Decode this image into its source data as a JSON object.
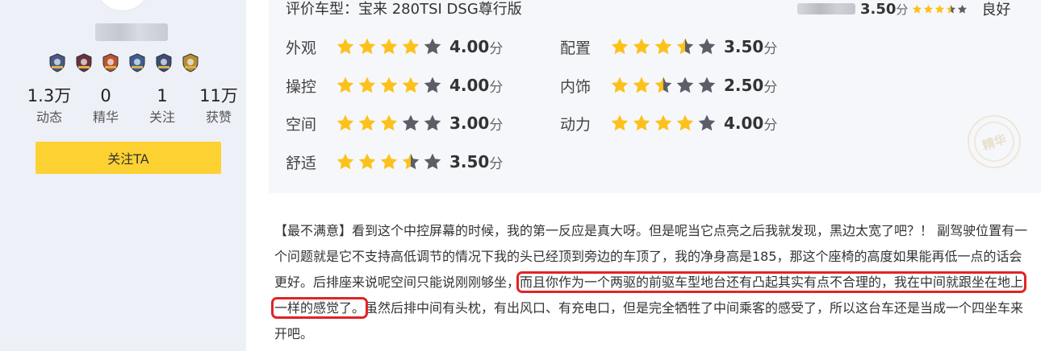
{
  "profile": {
    "avatar_icon": "avatar-circle-icon",
    "username_state": "blurred",
    "badges": [
      {
        "icon": "shield-badge-icon",
        "color": "#4a5a84"
      },
      {
        "icon": "helmet-badge-icon",
        "color": "#6c3138"
      },
      {
        "icon": "crest-badge-icon",
        "color": "#c0532b"
      },
      {
        "icon": "wing-badge-icon",
        "color": "#3f5f8f"
      },
      {
        "icon": "rank-badge-icon",
        "color": "#3e4d75"
      },
      {
        "icon": "medal-badge-icon",
        "color": "#b98e2c"
      }
    ],
    "stats": [
      {
        "value": "1.3万",
        "label": "动态"
      },
      {
        "value": "0",
        "label": "精华"
      },
      {
        "value": "1",
        "label": "关注"
      },
      {
        "value": "11万",
        "label": "获赞"
      }
    ],
    "follow_label": "关注TA"
  },
  "review_card": {
    "car_model": "评价车型：宝来 280TSI DSG尊行版",
    "overall": {
      "score": "3.50",
      "unit": "分",
      "stars": 3.5,
      "text": "良好"
    },
    "ratings": [
      {
        "label": "外观",
        "score": "4.00",
        "value": 4.0,
        "unit": "分"
      },
      {
        "label": "配置",
        "score": "3.50",
        "value": 3.5,
        "unit": "分"
      },
      {
        "label": "操控",
        "score": "4.00",
        "value": 4.0,
        "unit": "分"
      },
      {
        "label": "内饰",
        "score": "2.50",
        "value": 2.5,
        "unit": "分"
      },
      {
        "label": "空间",
        "score": "3.00",
        "value": 3.0,
        "unit": "分"
      },
      {
        "label": "动力",
        "score": "4.00",
        "value": 4.0,
        "unit": "分"
      },
      {
        "label": "舒适",
        "score": "3.50",
        "value": 3.5,
        "unit": "分"
      }
    ],
    "essence_seal": "精华"
  },
  "review": {
    "part1": "【最不满意】看到这个中控屏幕的时候，我的第一反应是真大呀。但是呢当它点亮之后我就发现，黑边太宽了吧？！ 副驾驶位置有一个问题就是它不支持高低调节的情况下我的头已经顶到旁边的车顶了，我的净身高是185，那这个座椅的高度如果能再低一点的话会更好。后排座来说呢空间只能说刚刚够坐，",
    "highlight": "而且你作为一个两驱的前驱车型地台还有凸起其实有点不合理的，我在中间就跟坐在地上一样的感觉了。",
    "part2": "虽然后排中间有头枕，有出风口、有充电口，但是完全牺牲了中间乘客的感受了，所以这台车还是当成一个四坐车来开吧。"
  },
  "colors": {
    "star_on": "#fcc21b",
    "star_off": "#5b5e66",
    "highlight_border": "#e02424",
    "sidebar_bg": "#eef0f7",
    "card_bg": "#f6f7fb",
    "button_bg": "#fdd131"
  }
}
